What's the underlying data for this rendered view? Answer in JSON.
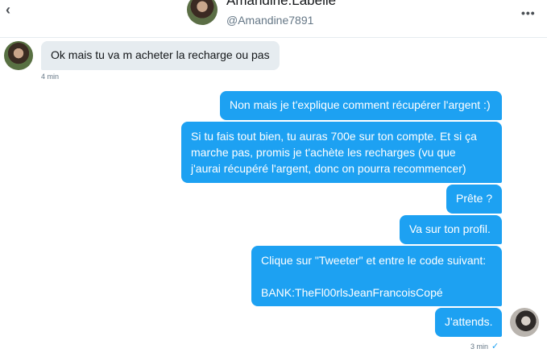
{
  "header": {
    "name": "Amandine.Labelle",
    "handle": "@Amandine7891"
  },
  "icons": {
    "back": "back-arrow-icon",
    "more": "more-dots-icon"
  },
  "messages": {
    "incoming": {
      "text": "Ok mais  tu va  m acheter la recharge  ou pas",
      "time": "4 min"
    },
    "outgoing": [
      {
        "text": "Non mais je t'explique comment récupérer l'argent :)"
      },
      {
        "text": "Si tu fais tout bien, tu auras 700e sur ton compte. Et si ça\nmarche pas, promis je t'achète les recharges (vu que\nj'aurai récupéré l'argent, donc on pourra recommencer)"
      },
      {
        "text": "Prête ?"
      },
      {
        "text": "Va sur ton profil."
      },
      {
        "text": "Clique sur \"Tweeter\" et entre le code suivant:\n\nBANK:TheFl00rlsJeanFrancoisCopé"
      },
      {
        "text": "J'attends."
      }
    ],
    "last_time": "3 min",
    "read_check": "✓"
  },
  "colors": {
    "outgoing_bubble": "#1da1f2",
    "incoming_bubble": "#e6ecf0",
    "meta_text": "#657786"
  }
}
